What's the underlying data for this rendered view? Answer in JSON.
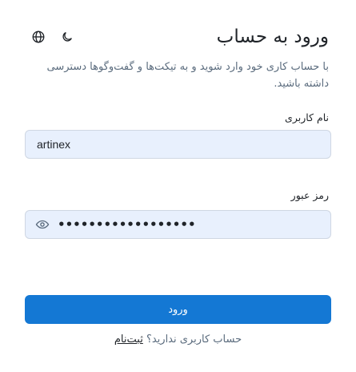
{
  "header": {
    "title": "ورود به حساب",
    "subtitle": "با حساب کاری خود وارد شوید و به تیکت‌ها و گفت‌وگوها دسترسی داشته باشید.",
    "language_icon": "globe-icon",
    "theme_icon": "moon-icon"
  },
  "form": {
    "username": {
      "label": "نام کاربری",
      "value": "artinex"
    },
    "password": {
      "label": "رمز عبور",
      "value": "••••••••••••••••••",
      "toggle_icon": "eye-icon"
    },
    "submit_label": "ورود"
  },
  "footer": {
    "prompt": "حساب کاربری ندارید؟",
    "link": "ثبت‌نام"
  },
  "colors": {
    "primary": "#1478d4",
    "field_bg": "#e8f0fd",
    "muted_text": "#5a6b7d"
  }
}
